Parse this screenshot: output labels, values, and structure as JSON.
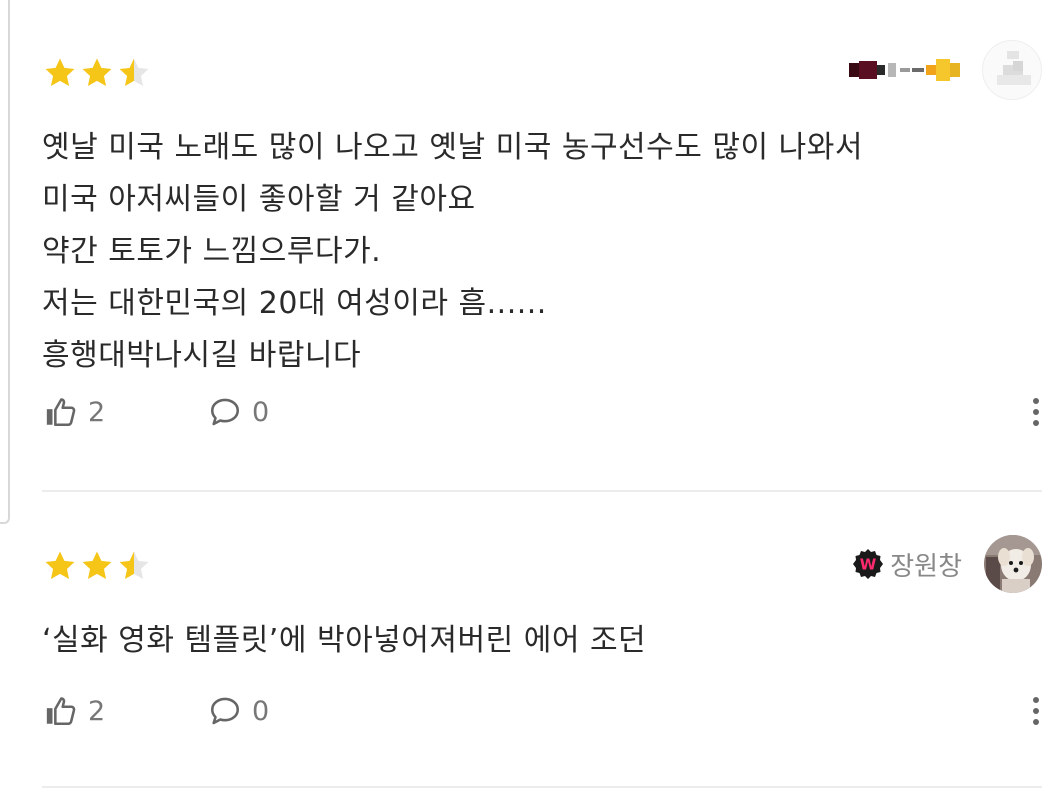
{
  "reviews": [
    {
      "rating": 2.5,
      "rating_max": 5,
      "user": {
        "name": "",
        "badge": "",
        "avatar": "blurred-avatar",
        "name_style": "pixelated"
      },
      "lines": [
        "옛날 미국 노래도 많이 나오고 옛날 미국 농구선수도 많이 나와서",
        "미국 아저씨들이 좋아할 거 같아요",
        "약간 토토가 느낌으루다가.",
        "저는 대한민국의 20대 여성이라 흠......",
        "흥행대박나시길 바랍니다"
      ],
      "likes": "2",
      "comments": "0",
      "icons": {
        "like": "thumbs-up-icon",
        "comment": "speech-bubble-icon",
        "more": "more-vertical-icon"
      }
    },
    {
      "rating": 2.5,
      "rating_max": 5,
      "user": {
        "name": "장원창",
        "badge": "W",
        "avatar": "dog-avatar"
      },
      "lines": [
        "‘실화 영화 템플릿’에 박아넣어져버린 에어 조던"
      ],
      "likes": "2",
      "comments": "0",
      "icons": {
        "like": "thumbs-up-icon",
        "comment": "speech-bubble-icon",
        "more": "more-vertical-icon"
      }
    }
  ],
  "colors": {
    "star_filled": "#f5c518",
    "star_empty": "#e6e6e6",
    "badge_bg": "#1a1a1a",
    "badge_fg": "#ff2a6d",
    "text": "#2a2a2a",
    "muted": "#777777"
  }
}
